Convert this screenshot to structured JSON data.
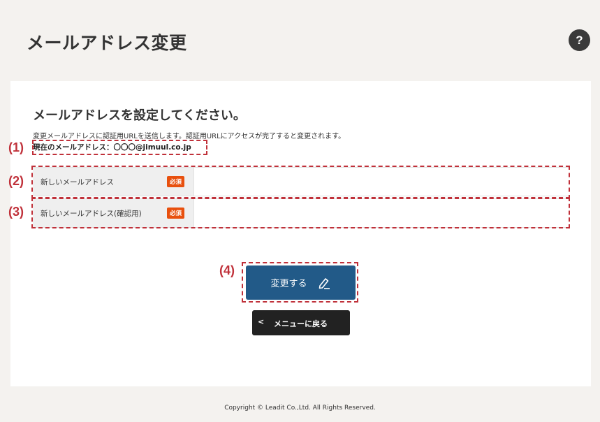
{
  "page": {
    "title": "メールアドレス変更",
    "help_label": "?"
  },
  "section": {
    "heading": "メールアドレスを設定してください。",
    "description": "変更メールアドレスに認証用URLを送信します。認証用URLにアクセスが完了すると変更されます。",
    "current_email": "現在のメールアドレス：〇〇〇@jimuul.co.jp"
  },
  "form": {
    "new_email_label": "新しいメールアドレス",
    "confirm_email_label": "新しいメールアドレス(確認用)",
    "required_badge": "必須",
    "new_email_value": "",
    "confirm_email_value": ""
  },
  "buttons": {
    "submit_label": "変更する",
    "back_label": "メニューに戻る",
    "back_chevron": "<"
  },
  "annotations": {
    "marker_1": "(1)",
    "marker_2": "(2)",
    "marker_3": "(3)",
    "marker_4": "(4)",
    "color": "#c0313a"
  },
  "footer": {
    "copyright": "Copyright © Leadit Co.,Ltd. All Rights Reserved."
  },
  "colors": {
    "background": "#f4f2ef",
    "primary_button": "#225a88",
    "back_button": "#222222",
    "required_badge": "#e8500e"
  }
}
